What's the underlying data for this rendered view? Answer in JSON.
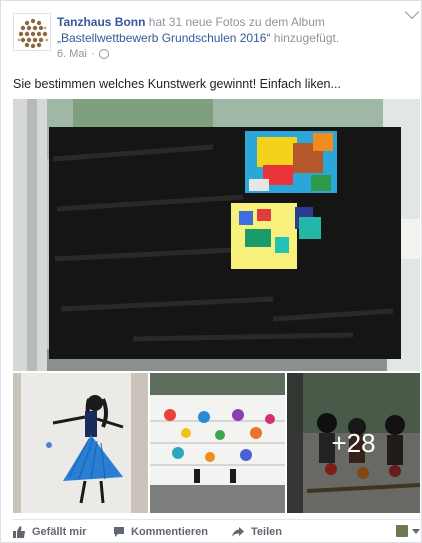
{
  "post": {
    "page_name": "Tanzhaus Bonn",
    "action_text": " hat 31 neue Fotos zu dem Album ",
    "album_title": "„Bastellwettbewerb Grundschulen 2016“",
    "action_suffix": " hinzugefügt.",
    "date": "6. Mai",
    "date_separator": "·",
    "text": "Sie bestimmen welches Kunstwerk gewinnt! Einfach liken..."
  },
  "photos": {
    "more_count_label": "+28"
  },
  "actions": {
    "like_label": "Gefällt mir",
    "comment_label": "Kommentieren",
    "share_label": "Teilen"
  },
  "icons": {
    "avatar": "tanzhaus-logo-icon",
    "privacy": "globe-icon",
    "options": "chevron-down-icon",
    "like": "thumbs-up-icon",
    "comment": "comment-icon",
    "share": "share-arrow-icon"
  }
}
